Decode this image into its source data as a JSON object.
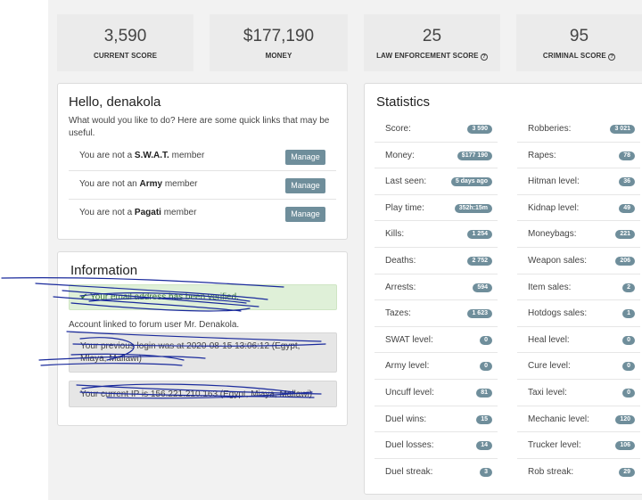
{
  "top_stats": [
    {
      "value": "3,590",
      "label": "CURRENT SCORE"
    },
    {
      "value": "$177,190",
      "label": "MONEY"
    },
    {
      "value": "25",
      "label": "LAW ENFORCEMENT SCORE",
      "help_icon": "?"
    },
    {
      "value": "95",
      "label": "CRIMINAL SCORE",
      "help_icon": "?"
    }
  ],
  "hello": {
    "title": "Hello, denakola",
    "intro": "What would you like to do? Here are some quick links that may be useful.",
    "memberships": [
      {
        "prefix": "You are not a",
        "group": "S.W.A.T.",
        "suffix": "member",
        "button": "Manage"
      },
      {
        "prefix": "You are not an",
        "group": "Army",
        "suffix": "member",
        "button": "Manage"
      },
      {
        "prefix": "You are not a",
        "group": "Pagati",
        "suffix": "member",
        "button": "Manage"
      }
    ]
  },
  "information": {
    "title": "Information",
    "verified": "Your email address has been verified.",
    "linked": "Account linked to forum user Mr. Denakola.",
    "last_login": "Your previous login was at 2020-08-15 13:06:12 (Egypt, Mlaya, Mallawi)",
    "current_ip": "Your current IP is 156.221.210.163 (Egypt, Miaya, Mallawi)"
  },
  "statistics": {
    "title": "Statistics",
    "left": [
      {
        "label": "Score:",
        "value": "3 590"
      },
      {
        "label": "Money:",
        "value": "$177 190"
      },
      {
        "label": "Last seen:",
        "value": "5 days ago"
      },
      {
        "label": "Play time:",
        "value": "352h:15m"
      },
      {
        "label": "Kills:",
        "value": "1 254"
      },
      {
        "label": "Deaths:",
        "value": "2 752"
      },
      {
        "label": "Arrests:",
        "value": "594"
      },
      {
        "label": "Tazes:",
        "value": "1 623"
      },
      {
        "label": "SWAT level:",
        "value": "0"
      },
      {
        "label": "Army level:",
        "value": "0"
      },
      {
        "label": "Uncuff level:",
        "value": "81"
      },
      {
        "label": "Duel wins:",
        "value": "15"
      },
      {
        "label": "Duel losses:",
        "value": "14"
      },
      {
        "label": "Duel streak:",
        "value": "3"
      }
    ],
    "right": [
      {
        "label": "Robberies:",
        "value": "3 021"
      },
      {
        "label": "Rapes:",
        "value": "78"
      },
      {
        "label": "Hitman level:",
        "value": "36"
      },
      {
        "label": "Kidnap level:",
        "value": "49"
      },
      {
        "label": "Moneybags:",
        "value": "221"
      },
      {
        "label": "Weapon sales:",
        "value": "206"
      },
      {
        "label": "Item sales:",
        "value": "2"
      },
      {
        "label": "Hotdogs sales:",
        "value": "1"
      },
      {
        "label": "Heal level:",
        "value": "0"
      },
      {
        "label": "Cure level:",
        "value": "0"
      },
      {
        "label": "Taxi level:",
        "value": "0"
      },
      {
        "label": "Mechanic level:",
        "value": "120"
      },
      {
        "label": "Trucker level:",
        "value": "106"
      },
      {
        "label": "Rob streak:",
        "value": "29"
      }
    ]
  },
  "colors": {
    "badge": "#6f8e9b",
    "button": "#6f8e9b",
    "alert_green": "#dff0d8",
    "scribble": "#1a2a9c"
  }
}
